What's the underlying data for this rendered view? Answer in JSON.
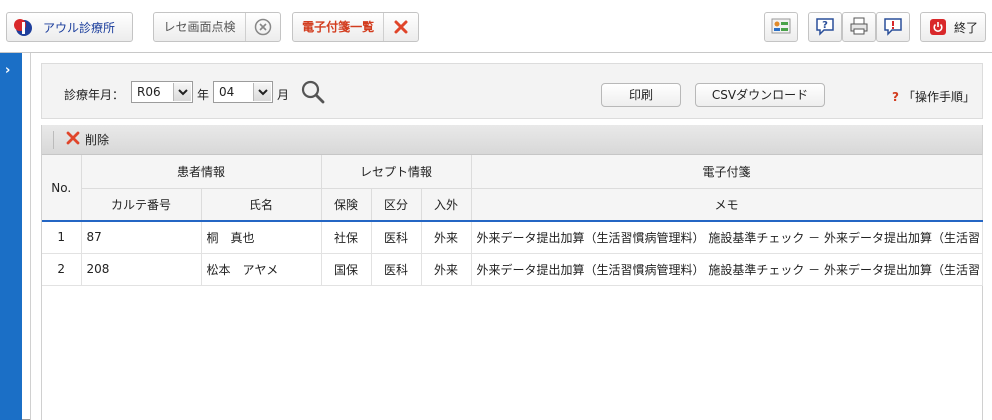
{
  "toolbar": {
    "clinic_name": "アウル診療所",
    "rece_check_label": "レセ画面点検",
    "fusen_list_label": "電子付箋一覧",
    "exit_label": "終了",
    "icons": [
      "staff-list-icon",
      "help-icon",
      "print-manual-icon",
      "alert-icon",
      "power-icon"
    ]
  },
  "filter": {
    "label": "診療年月：",
    "year_value": "R06",
    "year_unit": "年",
    "month_value": "04",
    "month_unit": "月",
    "print_label": "印刷",
    "csv_label": "CSVダウンロード",
    "help_label": "「操作手順」"
  },
  "actions": {
    "delete_label": "削除"
  },
  "table": {
    "headers": {
      "no": "No.",
      "patient_group": "患者情報",
      "receipt_group": "レセプト情報",
      "fusen_group": "電子付箋",
      "chart_no": "カルテ番号",
      "name": "氏名",
      "insurance": "保険",
      "category": "区分",
      "in_out": "入外",
      "memo": "メモ"
    },
    "rows": [
      {
        "no": "1",
        "chart_no": "87",
        "name": "桐　真也",
        "insurance": "社保",
        "category": "医科",
        "in_out": "外来",
        "memo": "外来データ提出加算（生活習慣病管理料） 施設基準チェック － 外来データ提出加算（生活習"
      },
      {
        "no": "2",
        "chart_no": "208",
        "name": "松本　アヤメ",
        "insurance": "国保",
        "category": "医科",
        "in_out": "外来",
        "memo": "外来データ提出加算（生活習慣病管理料） 施設基準チェック － 外来データ提出加算（生活習"
      }
    ]
  },
  "colors": {
    "accent_blue": "#1b6fc6",
    "red": "#d23c1e"
  }
}
